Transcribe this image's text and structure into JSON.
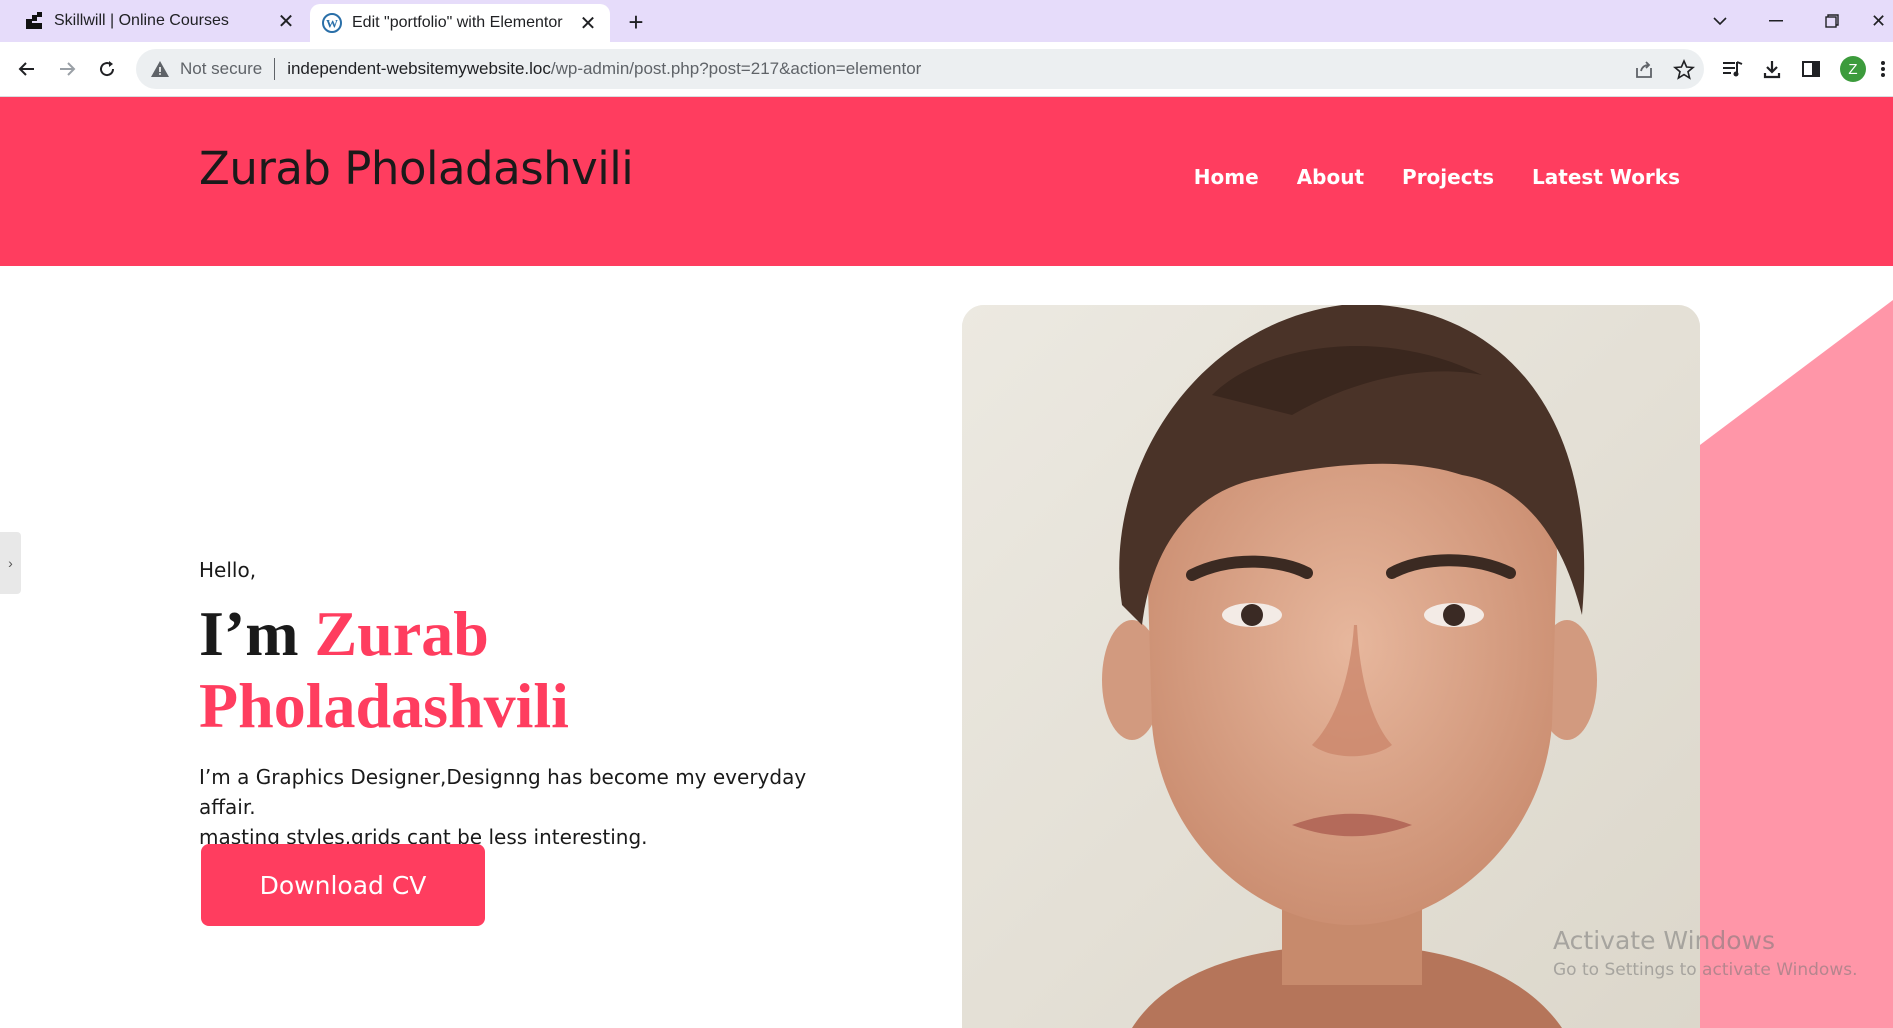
{
  "browser": {
    "tabs": [
      {
        "title": "Skillwill | Online Courses",
        "icon": "skillwill-logo-icon"
      },
      {
        "title": "Edit \"portfolio\" with Elementor",
        "icon": "wordpress-icon"
      }
    ],
    "omnibox": {
      "security_label": "Not secure",
      "url_host": "independent-websitemywebsite.loc",
      "url_path": "/wp-admin/post.php?post=217&action=elementor"
    },
    "profile_initial": "Z"
  },
  "site": {
    "logo": "Zurab Pholadashvili",
    "nav": [
      "Home",
      "About",
      "Projects",
      "Latest Works"
    ]
  },
  "hero": {
    "greeting": "Hello,",
    "headline_prefix": "I’m",
    "headline_name_1": "Zurab",
    "headline_name_2": "Pholadashvili",
    "description_line1": "I’m a Graphics Designer,Designng has become my everyday affair.",
    "description_line2": "masting styles,grids cant be less interesting.",
    "cta_label": "Download CV"
  },
  "watermark": {
    "title": "Activate Windows",
    "subtitle": "Go to Settings to activate Windows."
  },
  "colors": {
    "accent": "#ff3d5f",
    "tabbar": "#e6dcfa",
    "pink_shape": "#ff96a8"
  }
}
